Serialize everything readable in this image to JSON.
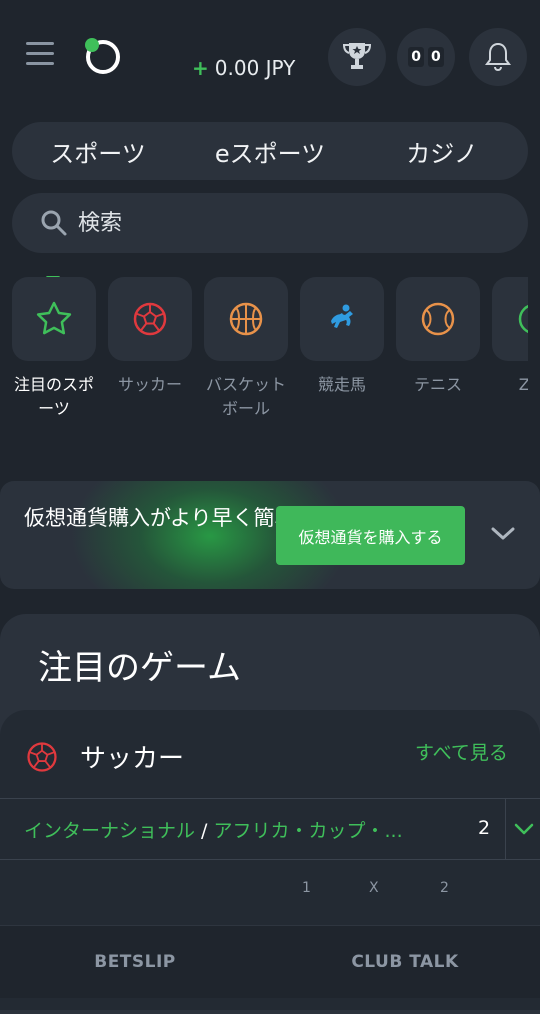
{
  "header": {
    "balance_sign": "+",
    "balance": "0.00 JPY",
    "score": [
      "0",
      "0"
    ]
  },
  "tabs": [
    {
      "label": "スポーツ"
    },
    {
      "label": "eスポーツ"
    },
    {
      "label": "カジノ"
    }
  ],
  "search": {
    "placeholder": "検索"
  },
  "categories": [
    {
      "label": "注目のスポーツ",
      "icon": "star-icon",
      "color": "#3fbf5a"
    },
    {
      "label": "サッカー",
      "icon": "soccer-ball-icon",
      "color": "#e0393e"
    },
    {
      "label": "バスケットボール",
      "icon": "basketball-icon",
      "color": "#e8924a"
    },
    {
      "label": "競走馬",
      "icon": "horse-racing-icon",
      "color": "#2f9be0"
    },
    {
      "label": "テニス",
      "icon": "tennis-ball-icon",
      "color": "#e8924a"
    },
    {
      "label": "Zeo",
      "icon": "zeo-icon",
      "color": "#3fbf5a"
    }
  ],
  "promo": {
    "text": "仮想通貨購入がより早く簡単に",
    "button": "仮想通貨を購入する"
  },
  "featured": {
    "title": "注目のゲーム",
    "section": "サッカー",
    "see_all": "すべて見る",
    "league_part1": "インターナショナル",
    "league_sep": " / ",
    "league_part2": "アフリカ・カップ・...",
    "league_count": "2",
    "odds_headers": [
      "1",
      "X",
      "2"
    ]
  },
  "bottom_bar": {
    "betslip": "BETSLIP",
    "club_talk": "CLUB TALK"
  },
  "colors": {
    "accent": "#3fbf5a",
    "background": "#1f252d",
    "panel": "#2b323c"
  }
}
